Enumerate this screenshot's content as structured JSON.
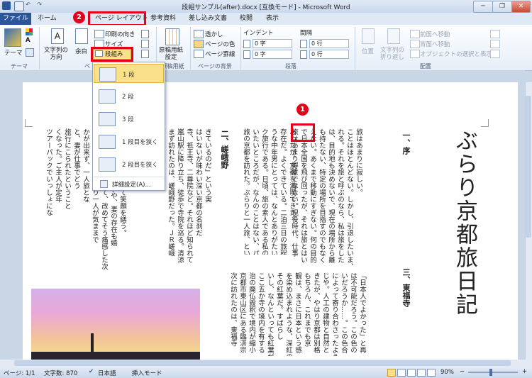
{
  "window": {
    "title": "段組サンプル(after).docx [互換モード] - Microsoft Word",
    "minimize": "─",
    "restore": "❐",
    "close": "✕"
  },
  "tabs": [
    "ファイル",
    "ホーム",
    "ページ レイアウト",
    "参考資料",
    "差し込み文書",
    "校閲",
    "表示"
  ],
  "ribbon": {
    "theme": {
      "themes": "テーマ",
      "group": "テーマ"
    },
    "page_setup": {
      "text_direction": "文字列の\n方向",
      "margins": "余白",
      "orientation": "印刷の向き",
      "size": "サイズ",
      "columns": "段組み",
      "group": "ペ"
    },
    "manuscript": {
      "label": "原稿用紙\n設定",
      "group": "原稿用紙"
    },
    "background": {
      "watermark": "透かし",
      "page_color": "ページの色",
      "page_border": "ページ罫線",
      "group": "ページの背景"
    },
    "paragraph": {
      "indent": "インデント",
      "spacing": "間隔",
      "indent_left": "0 字",
      "indent_right": "0 字",
      "spacing_before": "0 行",
      "spacing_after": "0 行",
      "group": "段落"
    },
    "arrange": {
      "position": "位置",
      "wrap": "文字列の\n折り返し",
      "bring_forward": "前面へ移動",
      "send_backward": "背面へ移動",
      "selection_pane": "オブジェクトの選択と表示",
      "group": "配置"
    }
  },
  "columns_menu": {
    "items": [
      {
        "label": "1 段",
        "icon": "one-column-icon",
        "selected": true
      },
      {
        "label": "2 段",
        "icon": "two-columns-icon",
        "selected": false
      },
      {
        "label": "3 段",
        "icon": "three-columns-icon",
        "selected": false
      },
      {
        "label": "1 段目を狭く",
        "icon": "left-narrow-icon",
        "selected": false
      },
      {
        "label": "2 段目を狭く",
        "icon": "right-narrow-icon",
        "selected": false
      }
    ],
    "more": "詳細設定(A)..."
  },
  "callouts": {
    "one": "1",
    "two": "2"
  },
  "document": {
    "title": "ぶらり京都旅日記",
    "heading_1": "一、序",
    "heading_2": "二、嵯峨野",
    "heading_3": "三、東福寺",
    "lines_col1": [
      "旅はあまり得意ではない。現役時代、仕事",
      "で日本全国を飛び回ったが、それは旅とはい",
      "えない。あくまで移動にすぎない。何の目的",
      "も持たない、特定の場所を目指すのでもなく",
      "は、目的地も決めないで、現在の場所から離",
      "れる。それを旅と呼ぶのなら、私は旅をした",
      "ことはほとんどない。しかし、引退したいま、",
      "旅はあまりに寂しい。"
    ],
    "lines_col2": [
      "旅の京都を訪れた。ぶらりと一人旅、とい",
      "いたいところだが、なんのことはない、パッ",
      "ク旅行である。日頃、旅の素人である私のよ",
      "うな中年男にとっては、なんとありがたい",
      "存在だ。よくできている。二泊三日の旅程で",
      "あったが、京都を満喫できた。"
    ],
    "lines_col3": [
      "まず訪れたのは、嵯峨野だった。ＪＲ嵯峨",
      "嵐山駅に降り立ち、徒歩で寺院を巡る。清涼",
      "寺、祇王寺、二尊院など。それほど知られて",
      "はいないが味わい深い京都の名刹だ",
      "きているのだ」という実"
    ],
    "lines_col4": [
      "ツアーパックでいっしょにな",
      "くなった。ご主人が定年",
      "旅行にこられたということ",
      "と、妻が仕事でどう",
      "かが出来ず、一人旅とな",
      "ってしまった。やはり一人が気ままで",
      "よい。山田夫妻を見て、改めてそう痛感した次",
      "第ではあったが、「いや、妻の存在も嬉",
      "しい」と言い聞かせて笑顔を繕う。"
    ],
    "lines_col5": [
      "次に訪れたのは、東福寺",
      "京都市東山区にある臨済宗",
      "治の廃仏毀釈で境内が縮小",
      "ここ五か寺の境内を有する",
      "いし、なんといっても紅葉が",
      "その紅葉だ。すばらし",
      "を染め込まれような、深紅の",
      "観は、まさに日本という感",
      "もちろん、これまでも京",
      "きたが、やはり京都は別格",
      "じや。人工の建物と自然と",
      "によって寄り合わさったよう",
      "いだろうか……。この色合",
      "は不可能だろう。この色の",
      "「日本人でよかった」と再"
    ]
  },
  "status": {
    "page": "ページ: 1/1",
    "words": "文字数: 870",
    "language": "日本語",
    "mode": "挿入モード",
    "zoom": "90%",
    "zoom_minus": "−",
    "zoom_plus": "+"
  }
}
